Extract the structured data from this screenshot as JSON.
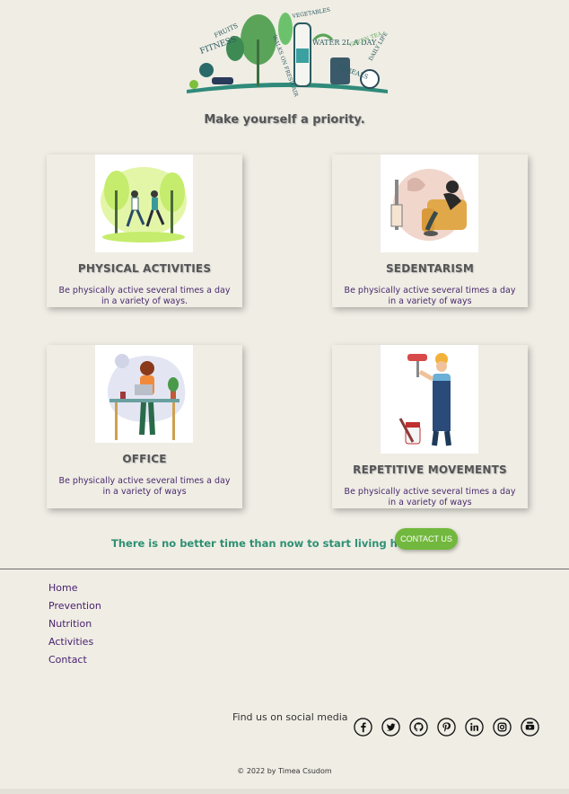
{
  "header": {
    "tagline": "Make yourself a priority.",
    "logo_words": [
      "FRUITS",
      "FITNESS",
      "WALKS ON FRESH AIR",
      "VEGETABLES",
      "WATER 2L A DAY",
      "GREEN TEA",
      "CEREALS",
      "DAILY LIFE"
    ]
  },
  "cards": [
    {
      "title": "PHYSICAL ACTIVITIES",
      "desc": "Be physically active several times a day in a variety of ways.",
      "image": "runners-illustration"
    },
    {
      "title": "SEDENTARISM",
      "desc": "Be physically active several times a day in a variety of ways",
      "image": "couch-sitting-illustration"
    },
    {
      "title": "OFFICE",
      "desc": "Be physically active several times a day in a variety of ways",
      "image": "desk-worker-illustration"
    },
    {
      "title": "REPETITIVE MOVEMENTS",
      "desc": "Be physically active several times a day in a variety of ways",
      "image": "painter-illustration"
    }
  ],
  "cta": {
    "text": "There is no better time than now to start living healthy.",
    "button": "CONTACT US"
  },
  "footer": {
    "nav": [
      "Home",
      "Prevention",
      "Nutrition",
      "Activities",
      "Contact"
    ],
    "social_label": "Find us on social media",
    "social_icons": [
      "facebook-icon",
      "twitter-icon",
      "github-icon",
      "pinterest-icon",
      "linkedin-icon",
      "instagram-icon",
      "youtube-icon"
    ],
    "copyright": "© 2022 by Timea Csudom"
  },
  "colors": {
    "background": "#efede4",
    "accent_green": "#72b83e",
    "cta_text": "#2e9073",
    "link_purple": "#4a2070"
  }
}
